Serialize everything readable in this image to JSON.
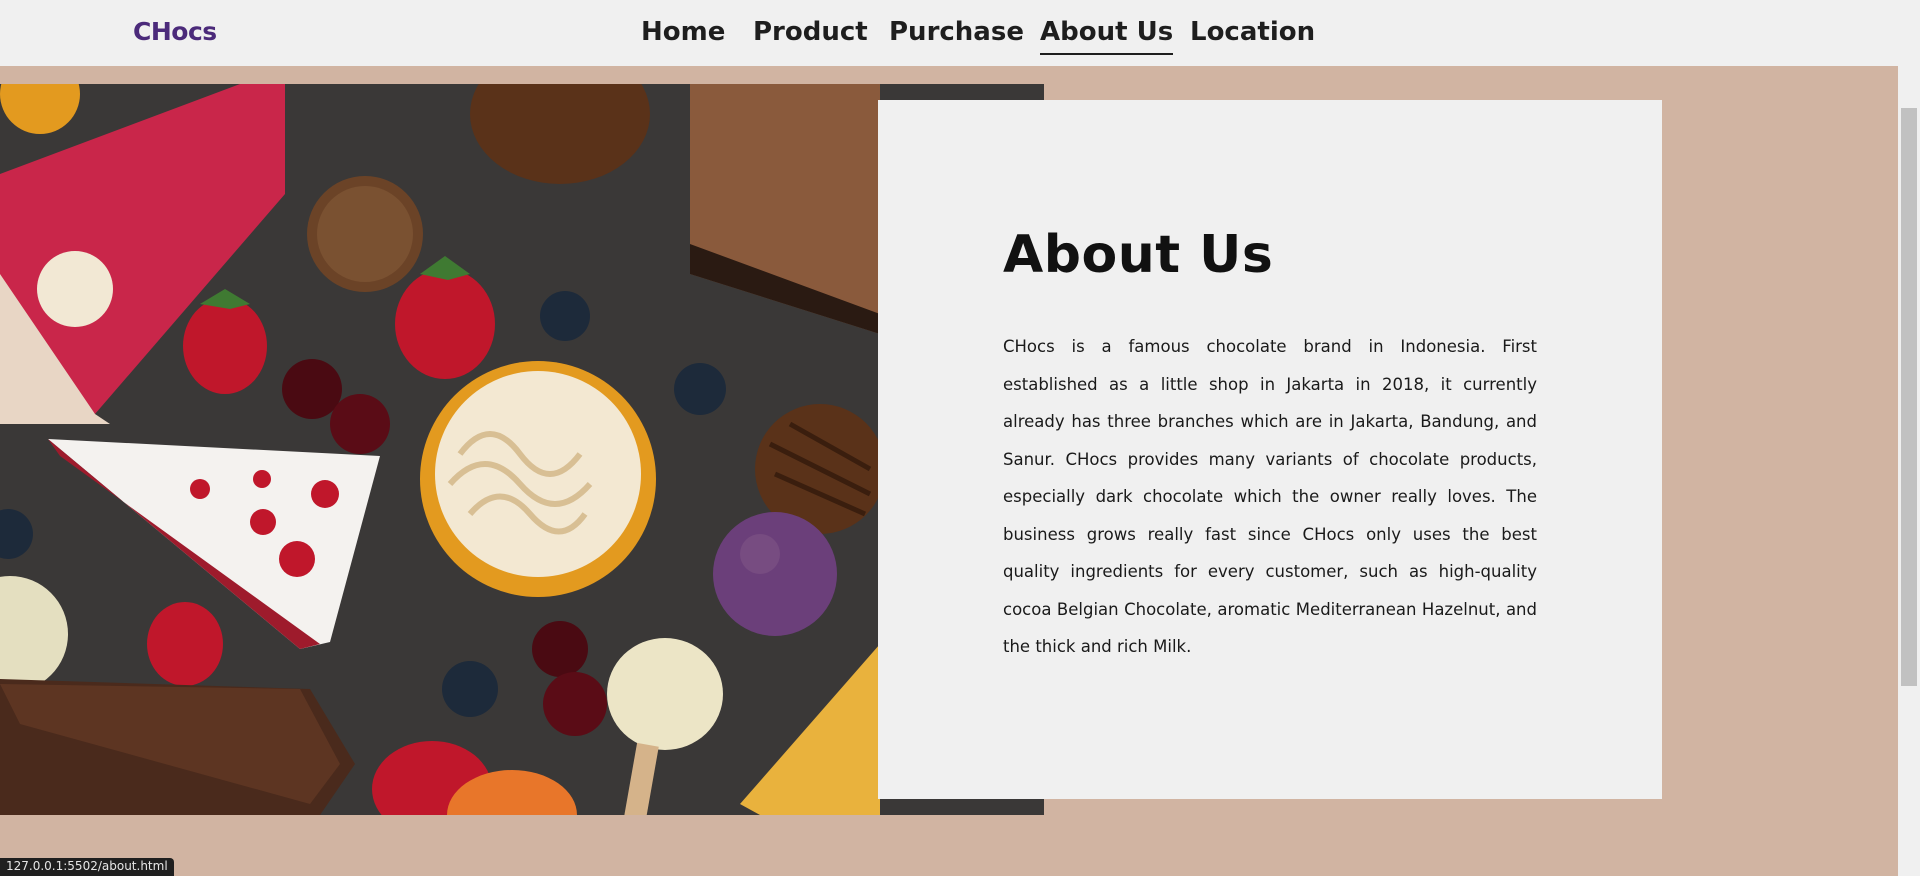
{
  "nav": {
    "brand": "CHocs",
    "links": [
      "Home",
      "Product",
      "Purchase",
      "About Us",
      "Location"
    ],
    "active": "About Us"
  },
  "about": {
    "title": "About Us",
    "body": "CHocs is a famous chocolate brand in Indonesia. First established as a little shop in Jakarta in 2018, it currently already has three branches which are in Jakarta, Bandung, and Sanur. CHocs provides many variants of chocolate products, especially dark chocolate which the owner really loves. The business grows really fast since CHocs only uses the best quality ingredients for every customer, such as high-quality cocoa Belgian Chocolate, aromatic Mediterranean Hazelnut, and the thick and rich Milk."
  },
  "status_bar": {
    "url": "127.0.0.1:5502/about.html"
  },
  "colors": {
    "page_background": "#d1b4a2",
    "navbar_background": "#f0f0f0",
    "brand": "#4b2a7a",
    "card_background": "#f0f0f0"
  }
}
